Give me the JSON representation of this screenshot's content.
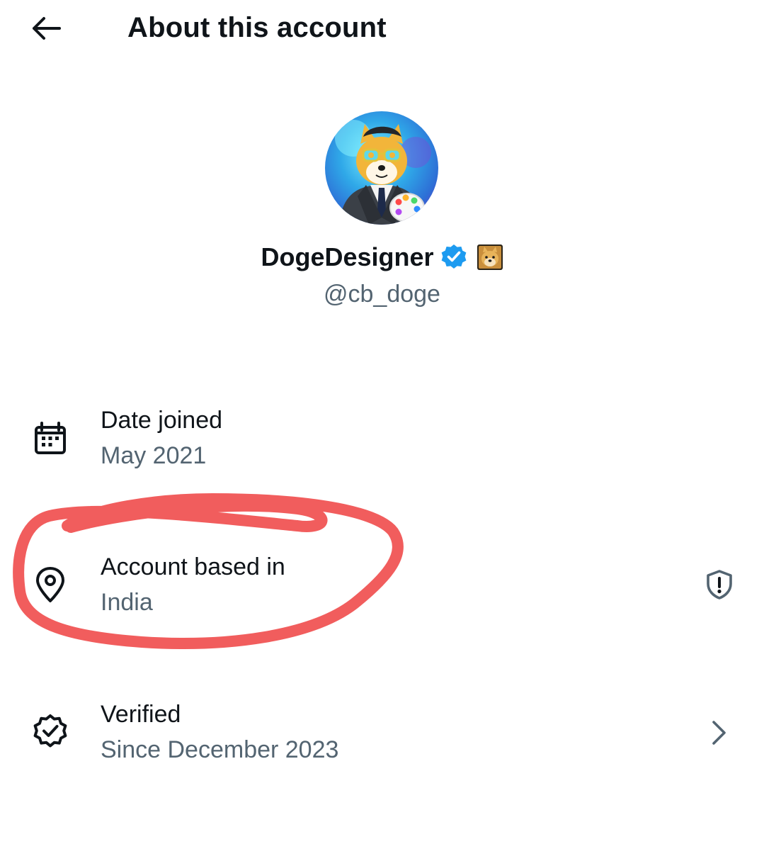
{
  "header": {
    "back_icon": "arrow-left-icon",
    "title": "About this account"
  },
  "profile": {
    "display_name": "DogeDesigner",
    "handle": "@cb_doge",
    "verified_icon": "verified-badge-icon",
    "verified_color": "#1d9bf0",
    "emoji_icon": "doge-emoji-icon"
  },
  "details": [
    {
      "icon": "calendar-icon",
      "title": "Date joined",
      "value": "May 2021"
    },
    {
      "icon": "location-pin-icon",
      "title": "Account based in",
      "value": "India",
      "trailing_icon": "shield-alert-icon"
    },
    {
      "icon": "verified-check-icon",
      "title": "Verified",
      "value": "Since December 2023",
      "trailing_icon": "chevron-right-icon"
    }
  ],
  "annotation": {
    "color": "#f05454"
  },
  "colors": {
    "text_primary": "#0f1419",
    "text_secondary": "#536471",
    "background": "#ffffff"
  }
}
